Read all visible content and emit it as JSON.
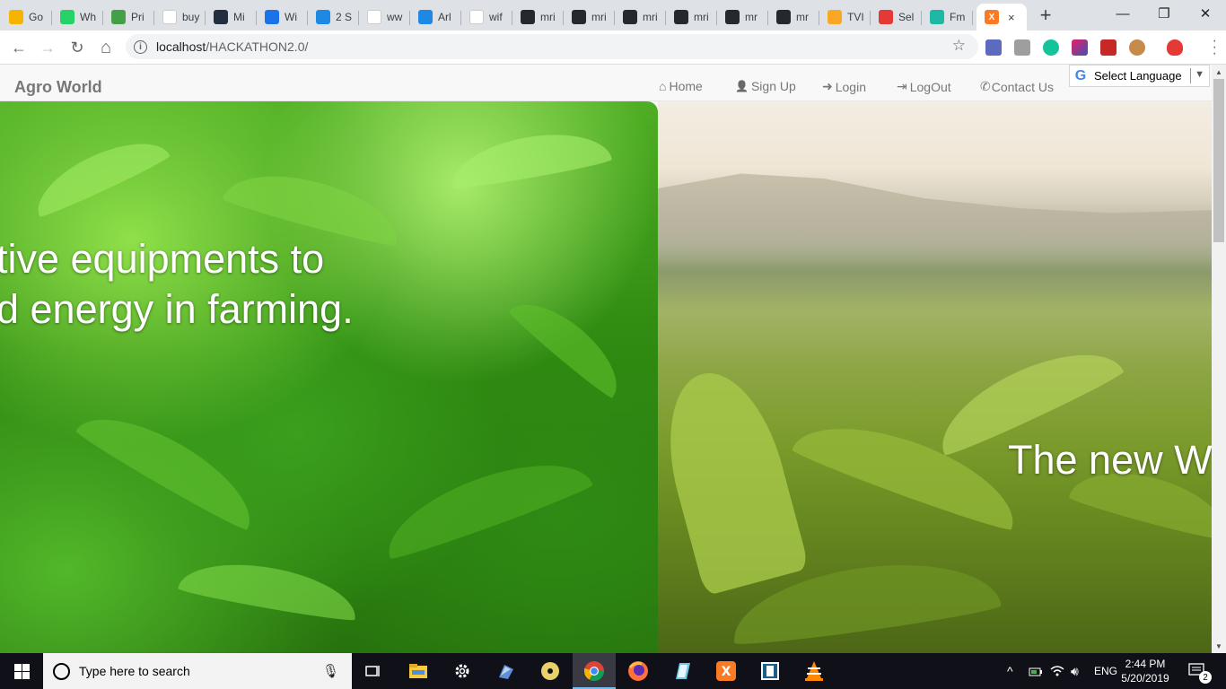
{
  "browser": {
    "tabs": [
      {
        "title": "Go",
        "icon": "bulb-icon",
        "color": "#f4b400"
      },
      {
        "title": "Wh",
        "icon": "whatsapp-icon",
        "color": "#25d366"
      },
      {
        "title": "Pri",
        "icon": "play-icon",
        "color": "#43a047"
      },
      {
        "title": "buy",
        "icon": "google-icon",
        "color": "#ffffff"
      },
      {
        "title": "Mi",
        "icon": "amazon-icon",
        "color": "#232f3e"
      },
      {
        "title": "Wi",
        "icon": "shield-icon",
        "color": "#1a73e8"
      },
      {
        "title": "2 S",
        "icon": "chat-icon",
        "color": "#1e88e5"
      },
      {
        "title": "ww",
        "icon": "w-icon",
        "color": "#ffffff"
      },
      {
        "title": "Arl",
        "icon": "cloud-icon",
        "color": "#1e88e5"
      },
      {
        "title": "wif",
        "icon": "google-icon",
        "color": "#ffffff"
      },
      {
        "title": "mri",
        "icon": "github-icon",
        "color": "#24292e"
      },
      {
        "title": "mri",
        "icon": "github-icon",
        "color": "#24292e"
      },
      {
        "title": "mri",
        "icon": "github-icon",
        "color": "#24292e"
      },
      {
        "title": "mri",
        "icon": "github-icon",
        "color": "#24292e"
      },
      {
        "title": "mr",
        "icon": "github-icon",
        "color": "#24292e"
      },
      {
        "title": "mr",
        "icon": "github-icon",
        "color": "#24292e"
      },
      {
        "title": "TVI",
        "icon": "tv-icon",
        "color": "#f9a825"
      },
      {
        "title": "Sel",
        "icon": "heart-shield-icon",
        "color": "#e53935"
      },
      {
        "title": "Fm",
        "icon": "play-circle-icon",
        "color": "#1db9a3"
      }
    ],
    "active_tab": {
      "icon": "xampp-icon",
      "color": "#fb7a24",
      "close": "×"
    },
    "new_tab": "+",
    "window_controls": {
      "minimize": "—",
      "restore": "❐",
      "close": "✕"
    },
    "nav": {
      "back": "←",
      "forward": "→",
      "reload": "↻",
      "home": "⌂"
    },
    "url_host": "localhost",
    "url_path": "/HACKATHON2.0/",
    "info_icon": "i",
    "star": "☆"
  },
  "site": {
    "brand": "Agro World",
    "nav_links": [
      {
        "label": "Home",
        "icon": "⌂",
        "icon_name": "home-icon"
      },
      {
        "label": "Sign Up",
        "icon": "👤",
        "icon_name": "user-icon"
      },
      {
        "label": "Login",
        "icon": "➜",
        "icon_name": "login-icon"
      },
      {
        "label": "LogOut",
        "icon": "⇥",
        "icon_name": "logout-icon"
      },
      {
        "label": "Contact Us",
        "icon": "✆",
        "icon_name": "phone-icon"
      }
    ],
    "translate": {
      "g": "G",
      "label": "Select Language",
      "arrow": "▼"
    },
    "slides": {
      "left_line1": "tive equipments to",
      "left_line2": "d energy in farming.",
      "right_text": "The new W"
    }
  },
  "taskbar": {
    "search_placeholder": "Type here to search",
    "mic": "🎙",
    "language": "ENG",
    "time": "2:44 PM",
    "date": "5/20/2019",
    "notifications": "2",
    "tray_chevron": "^"
  }
}
